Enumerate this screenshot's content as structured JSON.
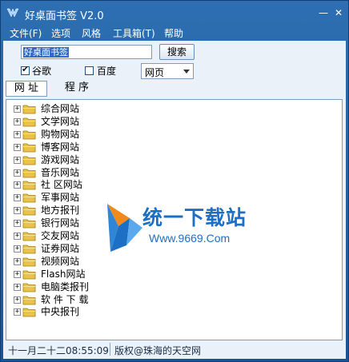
{
  "window": {
    "title": "好桌面书签 V2.0",
    "minimize_label": "—",
    "close_label": "✕"
  },
  "menu": {
    "items": [
      {
        "label": "文件(F)"
      },
      {
        "label": "选项"
      },
      {
        "label": "风格"
      },
      {
        "label": "工具箱(T)"
      },
      {
        "label": "帮助"
      }
    ]
  },
  "search": {
    "value": "好桌面书签",
    "button_label": "搜索",
    "engines": [
      {
        "label": "谷歌",
        "checked": true
      },
      {
        "label": "百度",
        "checked": false
      }
    ],
    "scope_selected": "网页"
  },
  "tabs": [
    {
      "label": "网 址",
      "active": true
    },
    {
      "label": "程 序",
      "active": false
    }
  ],
  "tree": {
    "expander_symbol": "+",
    "nodes": [
      {
        "label": "综合网站"
      },
      {
        "label": "文学网站"
      },
      {
        "label": "购物网站"
      },
      {
        "label": "博客网站"
      },
      {
        "label": "游戏网站"
      },
      {
        "label": "音乐网站"
      },
      {
        "label": "社 区网站"
      },
      {
        "label": "军事网站"
      },
      {
        "label": "地方报刊"
      },
      {
        "label": "银行网站"
      },
      {
        "label": "交友网站"
      },
      {
        "label": "证券网站"
      },
      {
        "label": "视频网站"
      },
      {
        "label": "Flash网站"
      },
      {
        "label": "电脑类报刊"
      },
      {
        "label": "软 件 下 载"
      },
      {
        "label": "中央报刊"
      }
    ]
  },
  "watermark": {
    "title": "统一下载站",
    "url": "Www.9669.Com"
  },
  "status": {
    "datetime": "十一月二十二08:55:09",
    "copyright": "版权@珠海的天空网"
  },
  "colors": {
    "frame": "#1f5a9c",
    "client": "#eaf1f9",
    "selection": "#316ac5",
    "folder": "#e8c24a",
    "watermark_blue": "#1d6fc4",
    "watermark_orange": "#f08a1c"
  }
}
